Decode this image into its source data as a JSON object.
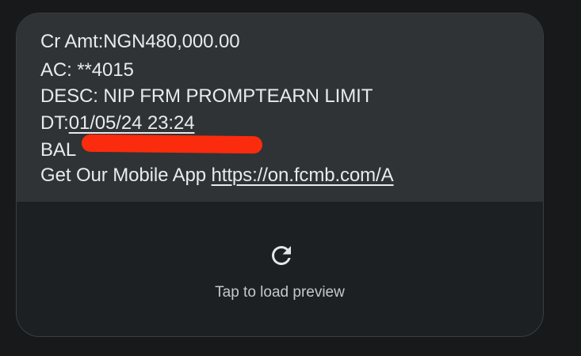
{
  "message": {
    "line1": "Cr Amt:NGN480,000.00",
    "line2": "AC: **4015",
    "line3": "DESC: NIP FRM PROMPTEARN LIMIT",
    "line4_prefix": "DT:",
    "line4_date": "01/05/24 23:24",
    "line5_prefix": "BAL",
    "line6_prefix": "Get Our Mobile App ",
    "line6_link": "https://on.fcmb.com/A",
    "redaction_color": "#fb2c0d"
  },
  "preview": {
    "icon": "reload-icon",
    "label": "Tap to load preview"
  }
}
